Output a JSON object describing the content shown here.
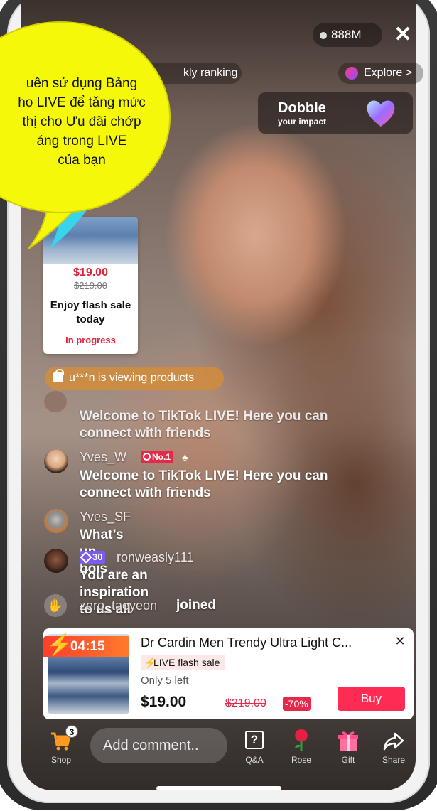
{
  "top_bar": {
    "viewer_count": "888M",
    "close_glyph": "✕",
    "ranking_label": "kly ranking",
    "explore_label": "Explore >"
  },
  "promo": {
    "title": "Dobble",
    "subtitle": "your impact",
    "icon": "purple-heart-icon"
  },
  "callout": {
    "text": "uên sử dụng Bảng\nho LIVE để tăng mức\nthị cho Ưu đãi chớp\náng trong LIVE\ncủa bạn",
    "color": "#f6f80a"
  },
  "flash_card": {
    "price": "$19.00",
    "old_price": "$219.00",
    "title": "Enjoy flash sale today",
    "status": "In progress"
  },
  "viewing": {
    "text": "u***n is viewing products"
  },
  "chat": {
    "faded_line": "Welcome to TikTok LIVE! Here you can connect with friends",
    "messages": [
      {
        "user": "Yves_W",
        "badge": "No.1",
        "text": "Welcome to TikTok LIVE! Here you can connect with friends"
      },
      {
        "user": "Yves_SF",
        "text": "What’s up bois"
      },
      {
        "user": "ronweasly111",
        "level": "30",
        "text": "You are an inspiration to us all"
      }
    ],
    "join_user": "zero_taeyeon",
    "join_text": "joined"
  },
  "product": {
    "timer": "04:15",
    "title": "Dr Cardin Men Trendy Ultra Light C...",
    "tag": "LIVE flash sale",
    "stock": "Only 5 left",
    "price": "$19.00",
    "old_price": "$219.00",
    "discount": "-70%",
    "buy_label": "Buy",
    "close_glyph": "✕"
  },
  "bottom_bar": {
    "shop_label": "Shop",
    "shop_badge": "3",
    "comment_placeholder": "Add comment..",
    "qa_label": "Q&A",
    "rose_label": "Rose",
    "gift_label": "Gift",
    "share_label": "Share"
  },
  "colors": {
    "accent": "#fe2c55",
    "flash_red": "#e5294b",
    "callout_yellow": "#f6f80a"
  }
}
